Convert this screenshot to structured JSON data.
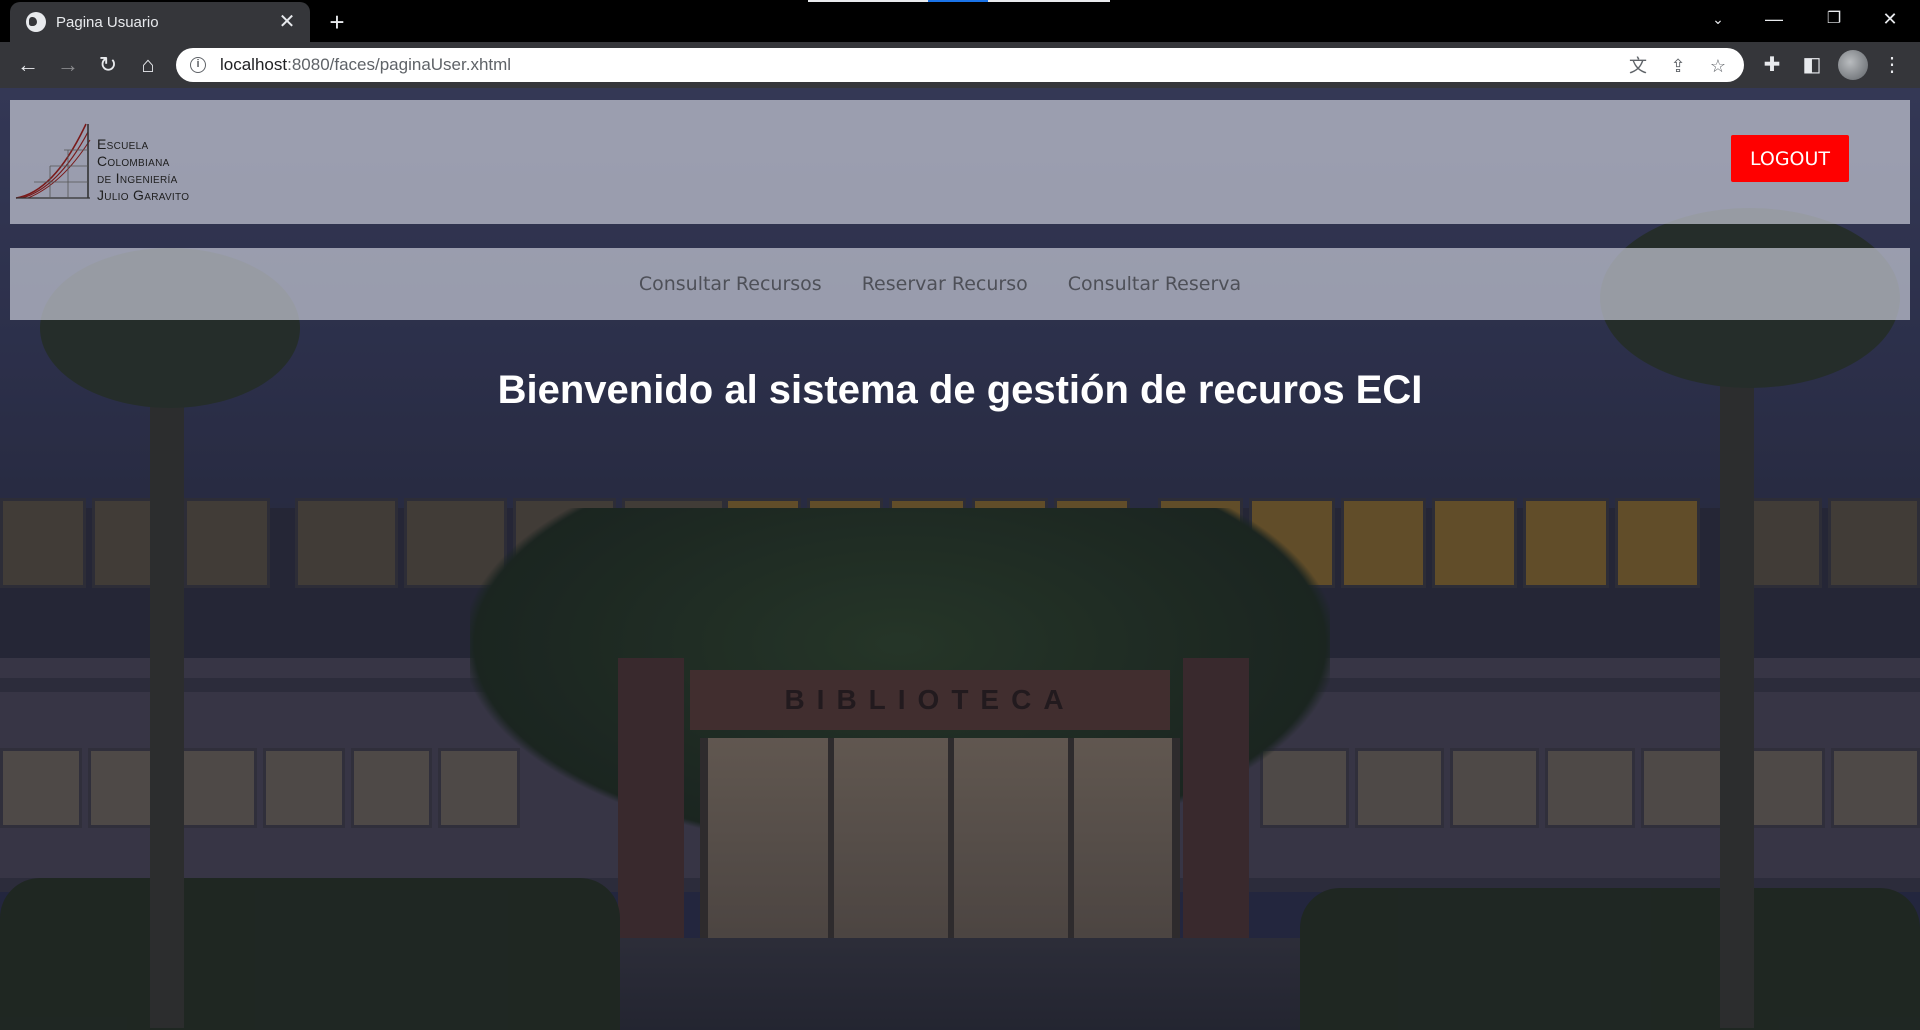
{
  "browser": {
    "tab_title": "Pagina Usuario",
    "url_host": "localhost",
    "url_path": ":8080/faces/paginaUser.xhtml"
  },
  "header": {
    "logo_lines": [
      "Escuela",
      "Colombiana",
      "de Ingeniería",
      "Julio Garavito"
    ],
    "logout_label": "LOGOUT"
  },
  "nav": {
    "items": [
      {
        "label": "Consultar Recursos"
      },
      {
        "label": "Reservar Recurso"
      },
      {
        "label": "Consultar Reserva"
      }
    ]
  },
  "main": {
    "welcome_title": "Bienvenido al sistema de gestión de recuros ECI",
    "building_sign": "BIBLIOTECA"
  },
  "colors": {
    "logout_bg": "#ff0000",
    "chrome_bg": "#35363a",
    "titlebar_bg": "#000000"
  }
}
